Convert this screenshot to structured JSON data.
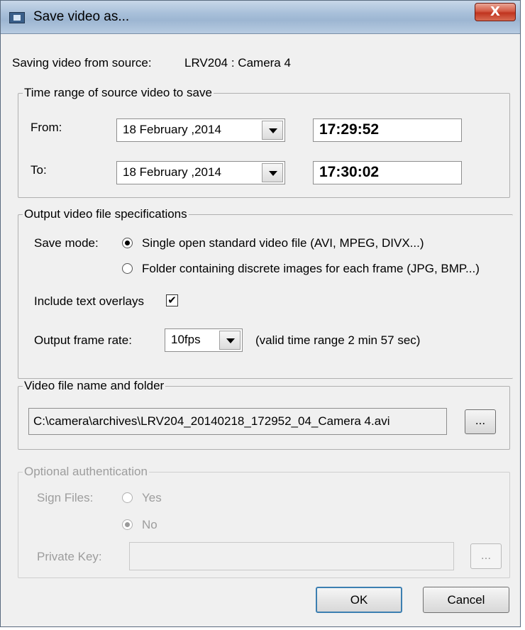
{
  "window": {
    "title": "Save video as...",
    "close_label": "X"
  },
  "source": {
    "label": "Saving video from source:",
    "value": "LRV204 : Camera 4"
  },
  "time_range": {
    "title": "Time range of source video to save",
    "from_label": "From:",
    "from_date": "18  February ,2014",
    "from_time": "17:29:52",
    "to_label": "To:",
    "to_date": "18  February ,2014",
    "to_time": "17:30:02"
  },
  "output_spec": {
    "title": "Output video file specifications",
    "save_mode_label": "Save mode:",
    "mode_options": [
      {
        "label": "Single open standard video file (AVI, MPEG, DIVX...)",
        "selected": true
      },
      {
        "label": "Folder containing discrete images for each frame (JPG, BMP...)",
        "selected": false
      }
    ],
    "overlays_label": "Include text overlays",
    "overlays_checked": true,
    "overlays_check_glyph": "✔",
    "frame_rate_label": "Output frame rate:",
    "frame_rate_value": "10fps",
    "valid_range_text": "(valid time range 2 min 57 sec)"
  },
  "file": {
    "title": "Video file name and folder",
    "path": "C:\\camera\\archives\\LRV204_20140218_172952_04_Camera 4.avi",
    "browse_label": "..."
  },
  "auth": {
    "title": "Optional authentication",
    "sign_label": "Sign Files:",
    "yes_label": "Yes",
    "no_label": "No",
    "key_label": "Private Key:",
    "key_value": "",
    "browse_label": "..."
  },
  "buttons": {
    "ok": "OK",
    "cancel": "Cancel"
  }
}
